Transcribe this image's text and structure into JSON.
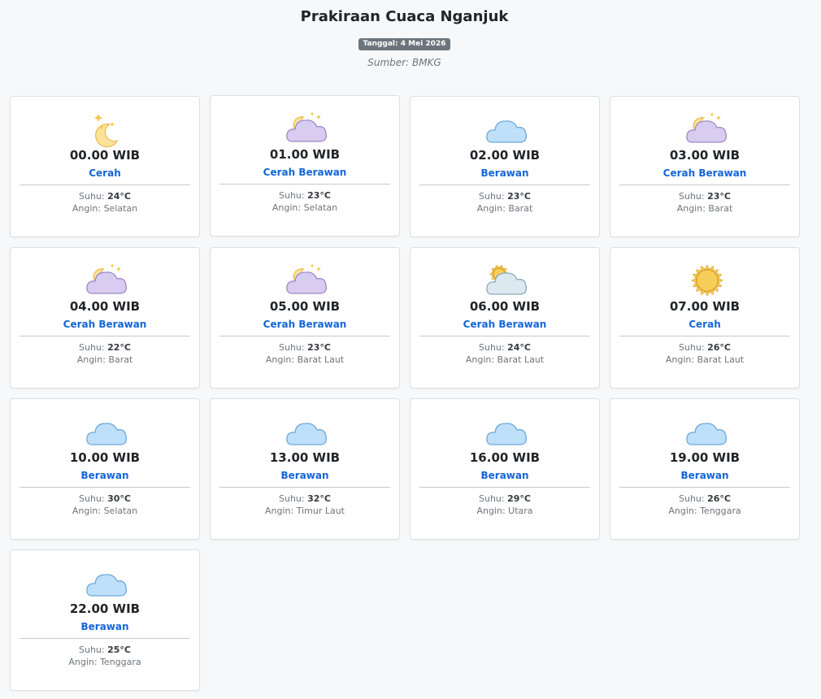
{
  "page": {
    "title": "Prakiraan Cuaca Nganjuk",
    "date_badge": "Tanggal: 4 Mei 2026",
    "source": "Sumber: BMKG"
  },
  "labels": {
    "temp": "Suhu:",
    "wind": "Angin:"
  },
  "forecasts": [
    {
      "time": "00.00 WIB",
      "condition": "Cerah",
      "temp": "24°C",
      "wind": "Selatan",
      "icon": "moon-stars-icon"
    },
    {
      "time": "01.00 WIB",
      "condition": "Cerah Berawan",
      "temp": "23°C",
      "wind": "Selatan",
      "icon": "moon-cloud-icon"
    },
    {
      "time": "02.00 WIB",
      "condition": "Berawan",
      "temp": "23°C",
      "wind": "Barat",
      "icon": "cloud-icon"
    },
    {
      "time": "03.00 WIB",
      "condition": "Cerah Berawan",
      "temp": "23°C",
      "wind": "Barat",
      "icon": "moon-cloud-icon"
    },
    {
      "time": "04.00 WIB",
      "condition": "Cerah Berawan",
      "temp": "22°C",
      "wind": "Barat",
      "icon": "moon-cloud-icon"
    },
    {
      "time": "05.00 WIB",
      "condition": "Cerah Berawan",
      "temp": "23°C",
      "wind": "Barat Laut",
      "icon": "moon-cloud-icon"
    },
    {
      "time": "06.00 WIB",
      "condition": "Cerah Berawan",
      "temp": "24°C",
      "wind": "Barat Laut",
      "icon": "sun-cloud-icon"
    },
    {
      "time": "07.00 WIB",
      "condition": "Cerah",
      "temp": "26°C",
      "wind": "Barat Laut",
      "icon": "sun-icon"
    },
    {
      "time": "10.00 WIB",
      "condition": "Berawan",
      "temp": "30°C",
      "wind": "Selatan",
      "icon": "cloud-icon"
    },
    {
      "time": "13.00 WIB",
      "condition": "Berawan",
      "temp": "32°C",
      "wind": "Timur Laut",
      "icon": "cloud-icon"
    },
    {
      "time": "16.00 WIB",
      "condition": "Berawan",
      "temp": "29°C",
      "wind": "Utara",
      "icon": "cloud-icon"
    },
    {
      "time": "19.00 WIB",
      "condition": "Berawan",
      "temp": "26°C",
      "wind": "Tenggara",
      "icon": "cloud-icon"
    },
    {
      "time": "22.00 WIB",
      "condition": "Berawan",
      "temp": "25°C",
      "wind": "Tenggara",
      "icon": "cloud-icon"
    }
  ],
  "colors": {
    "background": "#f7f8fa",
    "condition_text": "#1565d8",
    "badge": "#6c757d",
    "cloud_blue": "#bfe0fb",
    "cloud_purple": "#d8cdf0",
    "moon": "#fbe49a",
    "sun": "#f6cf5a"
  }
}
